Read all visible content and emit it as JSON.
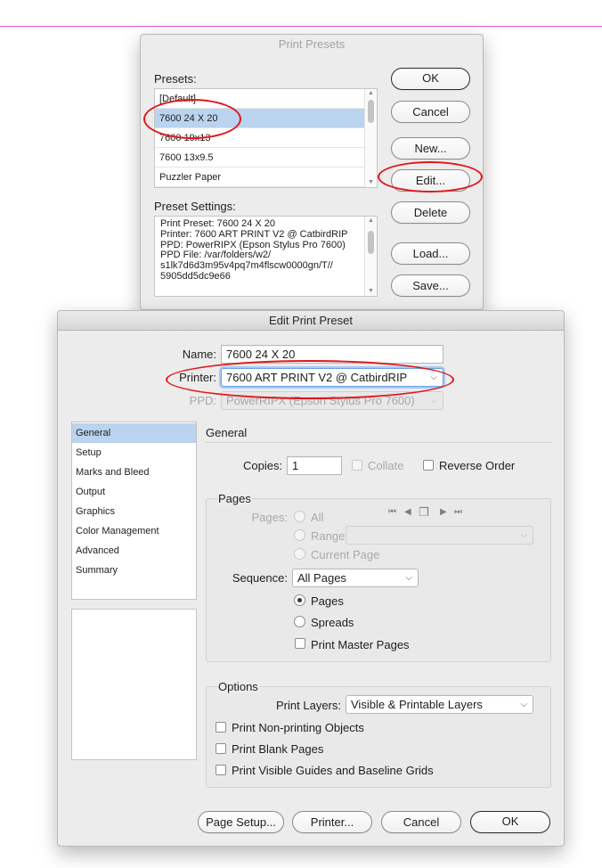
{
  "print_presets": {
    "title": "Print Presets",
    "presets_label": "Presets:",
    "presets": [
      "[Default]",
      "7600 24 X 20",
      "7600 19x13",
      "7600 13x9.5",
      "Puzzler Paper"
    ],
    "preset_settings_label": "Preset Settings:",
    "preset_settings_text": "Print Preset: 7600 24 X 20\nPrinter: 7600 ART PRINT V2 @ CatbirdRIP\nPPD: PowerRIPX (Epson Stylus Pro 7600)\nPPD File: /var/folders/w2/\ns1lk7d6d3m95v4pq7m4flscw0000gn/T//\n5905dd5dc9e66",
    "buttons": {
      "ok": "OK",
      "cancel": "Cancel",
      "new": "New...",
      "edit": "Edit...",
      "delete": "Delete",
      "load": "Load...",
      "save": "Save..."
    }
  },
  "edit_preset": {
    "title": "Edit Print Preset",
    "name_label": "Name:",
    "name_value": "7600 24 X 20",
    "printer_label": "Printer:",
    "printer_value": "7600 ART PRINT V2 @ CatbirdRIP",
    "ppd_label": "PPD:",
    "ppd_value": "PowerRIPX (Epson Stylus Pro 7600)",
    "sidebar": [
      "General",
      "Setup",
      "Marks and Bleed",
      "Output",
      "Graphics",
      "Color Management",
      "Advanced",
      "Summary"
    ],
    "section_title": "General",
    "copies_label": "Copies:",
    "copies_value": "1",
    "collate_label": "Collate",
    "reverse_order_label": "Reverse Order",
    "pages_group_title": "Pages",
    "pages_label": "Pages:",
    "all_label": "All",
    "range_label": "Range:",
    "current_page_label": "Current Page",
    "sequence_label": "Sequence:",
    "sequence_value": "All Pages",
    "pages_radio_label": "Pages",
    "spreads_radio_label": "Spreads",
    "print_master_pages_label": "Print Master Pages",
    "options_group_title": "Options",
    "print_layers_label": "Print Layers:",
    "print_layers_value": "Visible & Printable Layers",
    "print_nonprinting_label": "Print Non-printing Objects",
    "print_blank_label": "Print Blank Pages",
    "print_guides_label": "Print Visible Guides and Baseline Grids",
    "buttons": {
      "page_setup": "Page Setup...",
      "printer": "Printer...",
      "cancel": "Cancel",
      "ok": "OK"
    }
  },
  "colors": {
    "selection": "#bad3ee",
    "annotation": "#e0161a",
    "guide_line": "#e457d6"
  }
}
